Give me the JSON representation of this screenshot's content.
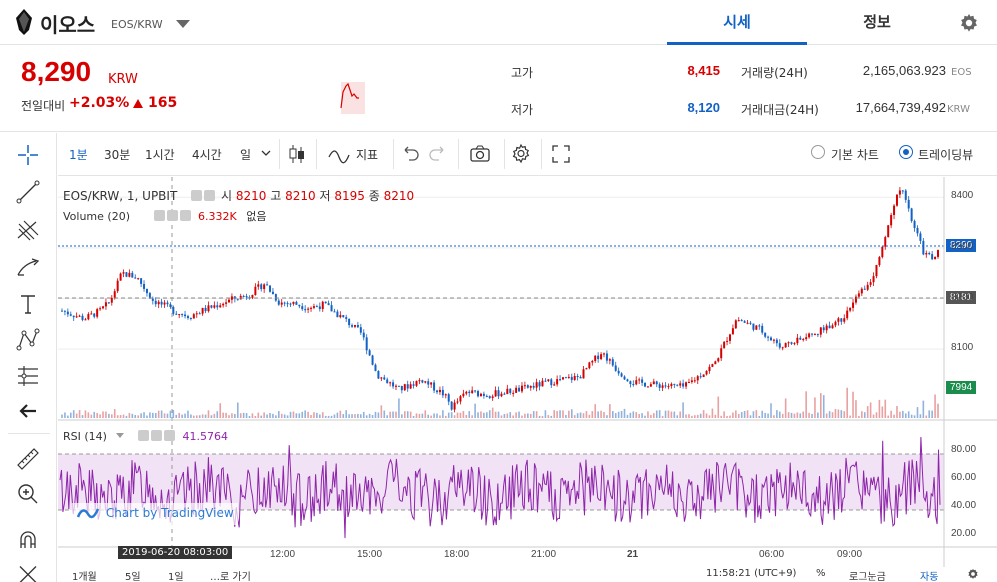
{
  "header": {
    "coin_name": "이오스",
    "pair": "EOS/KRW",
    "tabs": [
      {
        "label": "시세",
        "active": true
      },
      {
        "label": "정보",
        "active": false
      }
    ]
  },
  "price": {
    "current": "8,290",
    "unit": "KRW",
    "change_label": "전일대비",
    "change_pct": "+2.03%",
    "change_amount": "165",
    "high_label": "고가",
    "high": "8,415",
    "low_label": "저가",
    "low": "8,120",
    "volume_label": "거래량(24H)",
    "volume": "2,165,063.923",
    "volume_unit": "EOS",
    "amount_label": "거래대금(24H)",
    "amount": "17,664,739,492",
    "amount_unit": "KRW"
  },
  "toolbar": {
    "intervals": [
      "1분",
      "30분",
      "1시간",
      "4시간",
      "일"
    ],
    "indicators_label": "지표",
    "view_basic": "기본 차트",
    "view_trading": "트레이딩뷰"
  },
  "chart_legend": {
    "symbol": "EOS/KRW, 1, UPBIT",
    "o_label": "시",
    "o": "8210",
    "h_label": "고",
    "h": "8210",
    "l_label": "저",
    "l": "8195",
    "c_label": "종",
    "c": "8210",
    "volume_label": "Volume (20)",
    "volume_value": "6.332K",
    "volume_extra": "없음",
    "rsi_label": "RSI (14)",
    "rsi_value": "41.5764"
  },
  "price_tags": {
    "last": "8290",
    "line": "8181",
    "low": "7994"
  },
  "watermark": "Chart by TradingView",
  "crosshair_time": "2019-06-20 08:03:00",
  "bottom_bar": {
    "ranges": [
      "1개월",
      "5일",
      "1일"
    ],
    "goto": "…로 가기",
    "clock": "11:58:21 (UTC+9)",
    "percent": "%",
    "log": "로그눈금",
    "auto": "자동"
  },
  "colors": {
    "up": "#d60000",
    "down": "#1261c4",
    "rsi": "#8e24aa",
    "accent": "#1261c4"
  },
  "chart_data": {
    "type": "candlestick",
    "title": "EOS/KRW, 1, UPBIT",
    "x_ticks": [
      "12:00",
      "15:00",
      "18:00",
      "21:00",
      "21",
      "06:00",
      "09:00"
    ],
    "price_axis": {
      "ticks": [
        8400,
        8300,
        8200,
        8100
      ],
      "ylim": [
        7960,
        8440
      ]
    },
    "approx_close_path": [
      {
        "t": "06:45",
        "v": 8176
      },
      {
        "t": "07:30",
        "v": 8160
      },
      {
        "t": "08:00",
        "v": 8175
      },
      {
        "t": "08:20",
        "v": 8192
      },
      {
        "t": "08:45",
        "v": 8250
      },
      {
        "t": "09:15",
        "v": 8242
      },
      {
        "t": "09:45",
        "v": 8198
      },
      {
        "t": "10:30",
        "v": 8175
      },
      {
        "t": "11:00",
        "v": 8165
      },
      {
        "t": "11:30",
        "v": 8178
      },
      {
        "t": "12:30",
        "v": 8200
      },
      {
        "t": "13:00",
        "v": 8208
      },
      {
        "t": "13:30",
        "v": 8230
      },
      {
        "t": "14:00",
        "v": 8192
      },
      {
        "t": "14:30",
        "v": 8190
      },
      {
        "t": "15:00",
        "v": 8182
      },
      {
        "t": "15:30",
        "v": 8188
      },
      {
        "t": "16:15",
        "v": 8155
      },
      {
        "t": "16:45",
        "v": 8130
      },
      {
        "t": "17:15",
        "v": 8050
      },
      {
        "t": "18:00",
        "v": 8020
      },
      {
        "t": "18:45",
        "v": 8040
      },
      {
        "t": "19:30",
        "v": 8010
      },
      {
        "t": "19:45",
        "v": 7985
      },
      {
        "t": "20:15",
        "v": 8015
      },
      {
        "t": "21:00",
        "v": 8010
      },
      {
        "t": "22:00",
        "v": 8020
      },
      {
        "t": "23:00",
        "v": 8035
      },
      {
        "t": "00:00",
        "v": 8045
      },
      {
        "t": "00:45",
        "v": 8095
      },
      {
        "t": "01:15",
        "v": 8060
      },
      {
        "t": "01:45",
        "v": 8035
      },
      {
        "t": "02:30",
        "v": 8030
      },
      {
        "t": "03:30",
        "v": 8025
      },
      {
        "t": "04:30",
        "v": 8070
      },
      {
        "t": "05:15",
        "v": 8160
      },
      {
        "t": "06:00",
        "v": 8140
      },
      {
        "t": "06:45",
        "v": 8105
      },
      {
        "t": "07:30",
        "v": 8120
      },
      {
        "t": "08:15",
        "v": 8145
      },
      {
        "t": "08:45",
        "v": 8160
      },
      {
        "t": "09:15",
        "v": 8200
      },
      {
        "t": "09:45",
        "v": 8240
      },
      {
        "t": "10:05",
        "v": 8290
      },
      {
        "t": "10:30",
        "v": 8390
      },
      {
        "t": "10:45",
        "v": 8415
      },
      {
        "t": "11:10",
        "v": 8340
      },
      {
        "t": "11:30",
        "v": 8290
      },
      {
        "t": "11:50",
        "v": 8280
      },
      {
        "t": "11:58",
        "v": 8290
      }
    ],
    "rsi": {
      "name": "RSI (14)",
      "ticks": [
        80,
        60,
        40,
        20
      ],
      "upper": 70,
      "lower": 30,
      "last": 41.5764
    }
  }
}
